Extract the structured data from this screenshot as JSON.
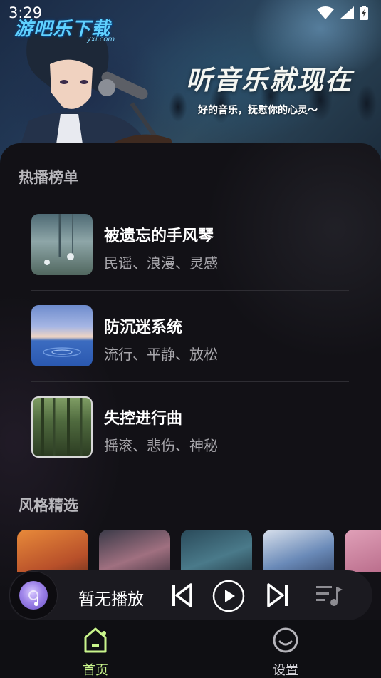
{
  "status_bar": {
    "time": "3:29"
  },
  "banner": {
    "logo": "游吧乐下载",
    "logo_sub": "yxi.com",
    "headline": "听音乐就现在",
    "subline": "好的音乐，抚慰你的心灵～"
  },
  "hot_list": {
    "title": "热播榜单",
    "songs": [
      {
        "title": "被遗忘的手风琴",
        "tags": "民谣、浪漫、灵感"
      },
      {
        "title": "防沉迷系统",
        "tags": "流行、平静、放松"
      },
      {
        "title": "失控进行曲",
        "tags": "摇滚、悲伤、神秘"
      }
    ]
  },
  "style_picks": {
    "title": "风格精选"
  },
  "player": {
    "now_playing": "暂无播放"
  },
  "nav": {
    "items": [
      {
        "label": "首页",
        "icon": "home-icon",
        "active": true
      },
      {
        "label": "设置",
        "icon": "smile-icon",
        "active": false
      }
    ]
  },
  "colors": {
    "accent": "#c9f58c",
    "panel_bg": "#121116",
    "muted_text": "#a9a8ad"
  }
}
